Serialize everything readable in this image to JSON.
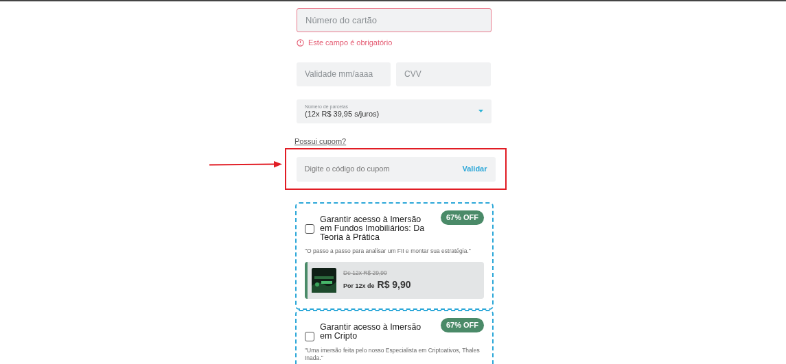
{
  "card_number": {
    "placeholder": "Número do cartão",
    "error": true,
    "error_message": "Este campo é obrigatório"
  },
  "expiry": {
    "placeholder": "Validade mm/aaaa"
  },
  "cvv": {
    "placeholder": "CVV"
  },
  "installments": {
    "label": "Número de parcelas",
    "value": "(12x R$ 39,95 s/juros)"
  },
  "coupon": {
    "link": "Possui cupom?",
    "placeholder": "Digite o código do cupom",
    "button": "Validar",
    "highlighted": true
  },
  "offers": [
    {
      "checked": false,
      "badge": "67% OFF",
      "title": "Garantir acesso à Imersão em Fundos Imobiliários: Da Teoria à Prática",
      "quote": "\"O passo a passo para analisar um FII e montar sua estratégia.\"",
      "old_price": "De 12x R$ 29,90",
      "price_prefix": "Por 12x de",
      "price": "R$ 9,90"
    },
    {
      "checked": false,
      "badge": "67% OFF",
      "title": "Garantir acesso à Imersão em Cripto",
      "quote": "\"Uma imersão feita pelo nosso Especialista em Criptoativos, Thales Inada.\""
    }
  ]
}
